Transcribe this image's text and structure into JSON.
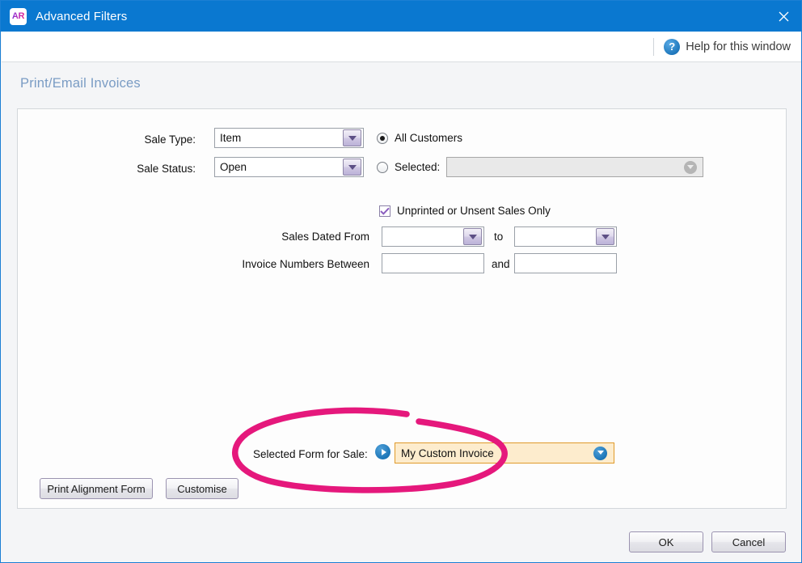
{
  "window": {
    "title": "Advanced Filters",
    "icon_label": "AR",
    "icon_name": "ar-app-icon",
    "close_icon": "close-icon"
  },
  "helpbar": {
    "icon": "question-mark-icon",
    "icon_glyph": "?",
    "label": "Help for this window"
  },
  "page": {
    "title": "Print/Email Invoices"
  },
  "form": {
    "sale_type": {
      "label": "Sale Type:",
      "value": "Item",
      "arrow_icon": "chevron-down-icon"
    },
    "sale_status": {
      "label": "Sale Status:",
      "value": "Open",
      "arrow_icon": "chevron-down-icon"
    },
    "customer_scope": {
      "all_customers": {
        "label": "All Customers",
        "selected": true
      },
      "selected": {
        "label": "Selected:",
        "selected": false,
        "field_value": "",
        "field_enabled": false,
        "picker_icon": "circle-down-arrow-icon"
      }
    },
    "unprinted_checkbox": {
      "label": "Unprinted or Unsent Sales Only",
      "checked": true,
      "check_icon": "checkmark-icon"
    },
    "sales_dated": {
      "label": "Sales Dated From",
      "from_value": "",
      "separator": "to",
      "to_value": "",
      "arrow_icon": "chevron-down-icon"
    },
    "invoice_numbers": {
      "label": "Invoice Numbers Between",
      "from_value": "",
      "separator": "and",
      "to_value": ""
    },
    "selected_form": {
      "label": "Selected Form for Sale:",
      "go_icon": "circle-right-arrow-icon",
      "value": "My Custom Invoice",
      "picker_icon": "circle-down-arrow-icon",
      "highlighted": true
    }
  },
  "buttons": {
    "print_alignment_form": "Print Alignment Form",
    "customise": "Customise",
    "ok": "OK",
    "cancel": "Cancel"
  },
  "annotation": {
    "shape": "hand-drawn-ellipse",
    "color": "#e5187c",
    "targets": "Selected Form for Sale field"
  },
  "colors": {
    "titlebar": "#0a78d0",
    "accent_blue": "#1a73b5",
    "highlight_field_bg": "#fdeccd",
    "highlight_field_border": "#e09a2a",
    "annotation_pink": "#e5187c",
    "page_title": "#7a9cc4"
  }
}
